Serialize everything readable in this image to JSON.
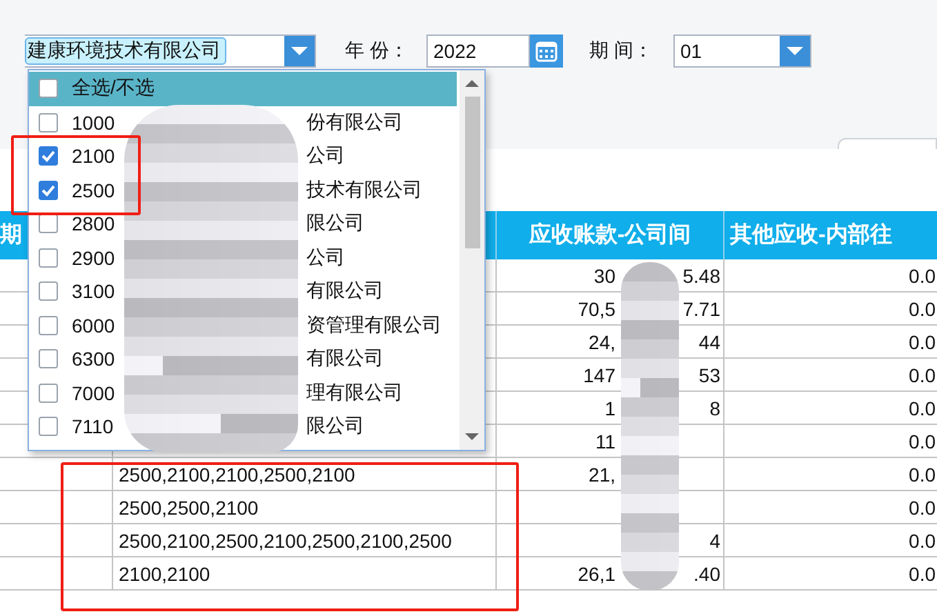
{
  "company_select": {
    "value": "建康环境技术有限公司"
  },
  "year": {
    "label": "年 份：",
    "value": "2022"
  },
  "period": {
    "label": "期 间：",
    "value": "01"
  },
  "company_dropdown": {
    "select_all": {
      "label": "全选/不选",
      "checked": false
    },
    "items": [
      {
        "code": "1000",
        "name_end": "份有限公司",
        "checked": false
      },
      {
        "code": "2100",
        "name_end": "公司",
        "checked": true
      },
      {
        "code": "2500",
        "name_end": "技术有限公司",
        "checked": true
      },
      {
        "code": "2800",
        "name_end": "限公司",
        "checked": false
      },
      {
        "code": "2900",
        "name_end": "公司",
        "checked": false
      },
      {
        "code": "3100",
        "name_end": "有限公司",
        "checked": false
      },
      {
        "code": "6000",
        "name_end": "资管理有限公司",
        "checked": false
      },
      {
        "code": "6300",
        "name_end": "有限公司",
        "checked": false
      },
      {
        "code": "7000",
        "name_end": "理有限公司",
        "checked": false
      },
      {
        "code": "7110",
        "name_end": "限公司",
        "checked": false
      }
    ]
  },
  "table": {
    "headers": {
      "column_1": "期",
      "receivable": "应收账款-公司间",
      "other": "其他应收-内部往"
    },
    "rows": [
      {
        "amount_start": "30",
        "amount_end": "5.48",
        "other": "0.0"
      },
      {
        "amount_start": "70,5",
        "amount_end": "7.71",
        "other": "0.0"
      },
      {
        "amount_start": "24,",
        "amount_end": "44",
        "other": "0.0"
      },
      {
        "amount_start": "147",
        "amount_end": "53",
        "other": "0.0"
      },
      {
        "amount_start": "1",
        "amount_end": "8",
        "other": "0.0"
      },
      {
        "amount_start": "11",
        "other": "0.0"
      },
      {
        "codes": "2500,2100,2100,2500,2100",
        "amount_start": "21,",
        "other": "0.0"
      },
      {
        "codes": "2500,2500,2100",
        "other": "0.0"
      },
      {
        "codes": "2500,2100,2500,2100,2500,2100,2500",
        "amount_end": "4",
        "other": "0.0"
      },
      {
        "codes": "2100,2100",
        "amount_start": "26,1",
        "amount_end": ".40",
        "other": "0.0"
      }
    ]
  }
}
